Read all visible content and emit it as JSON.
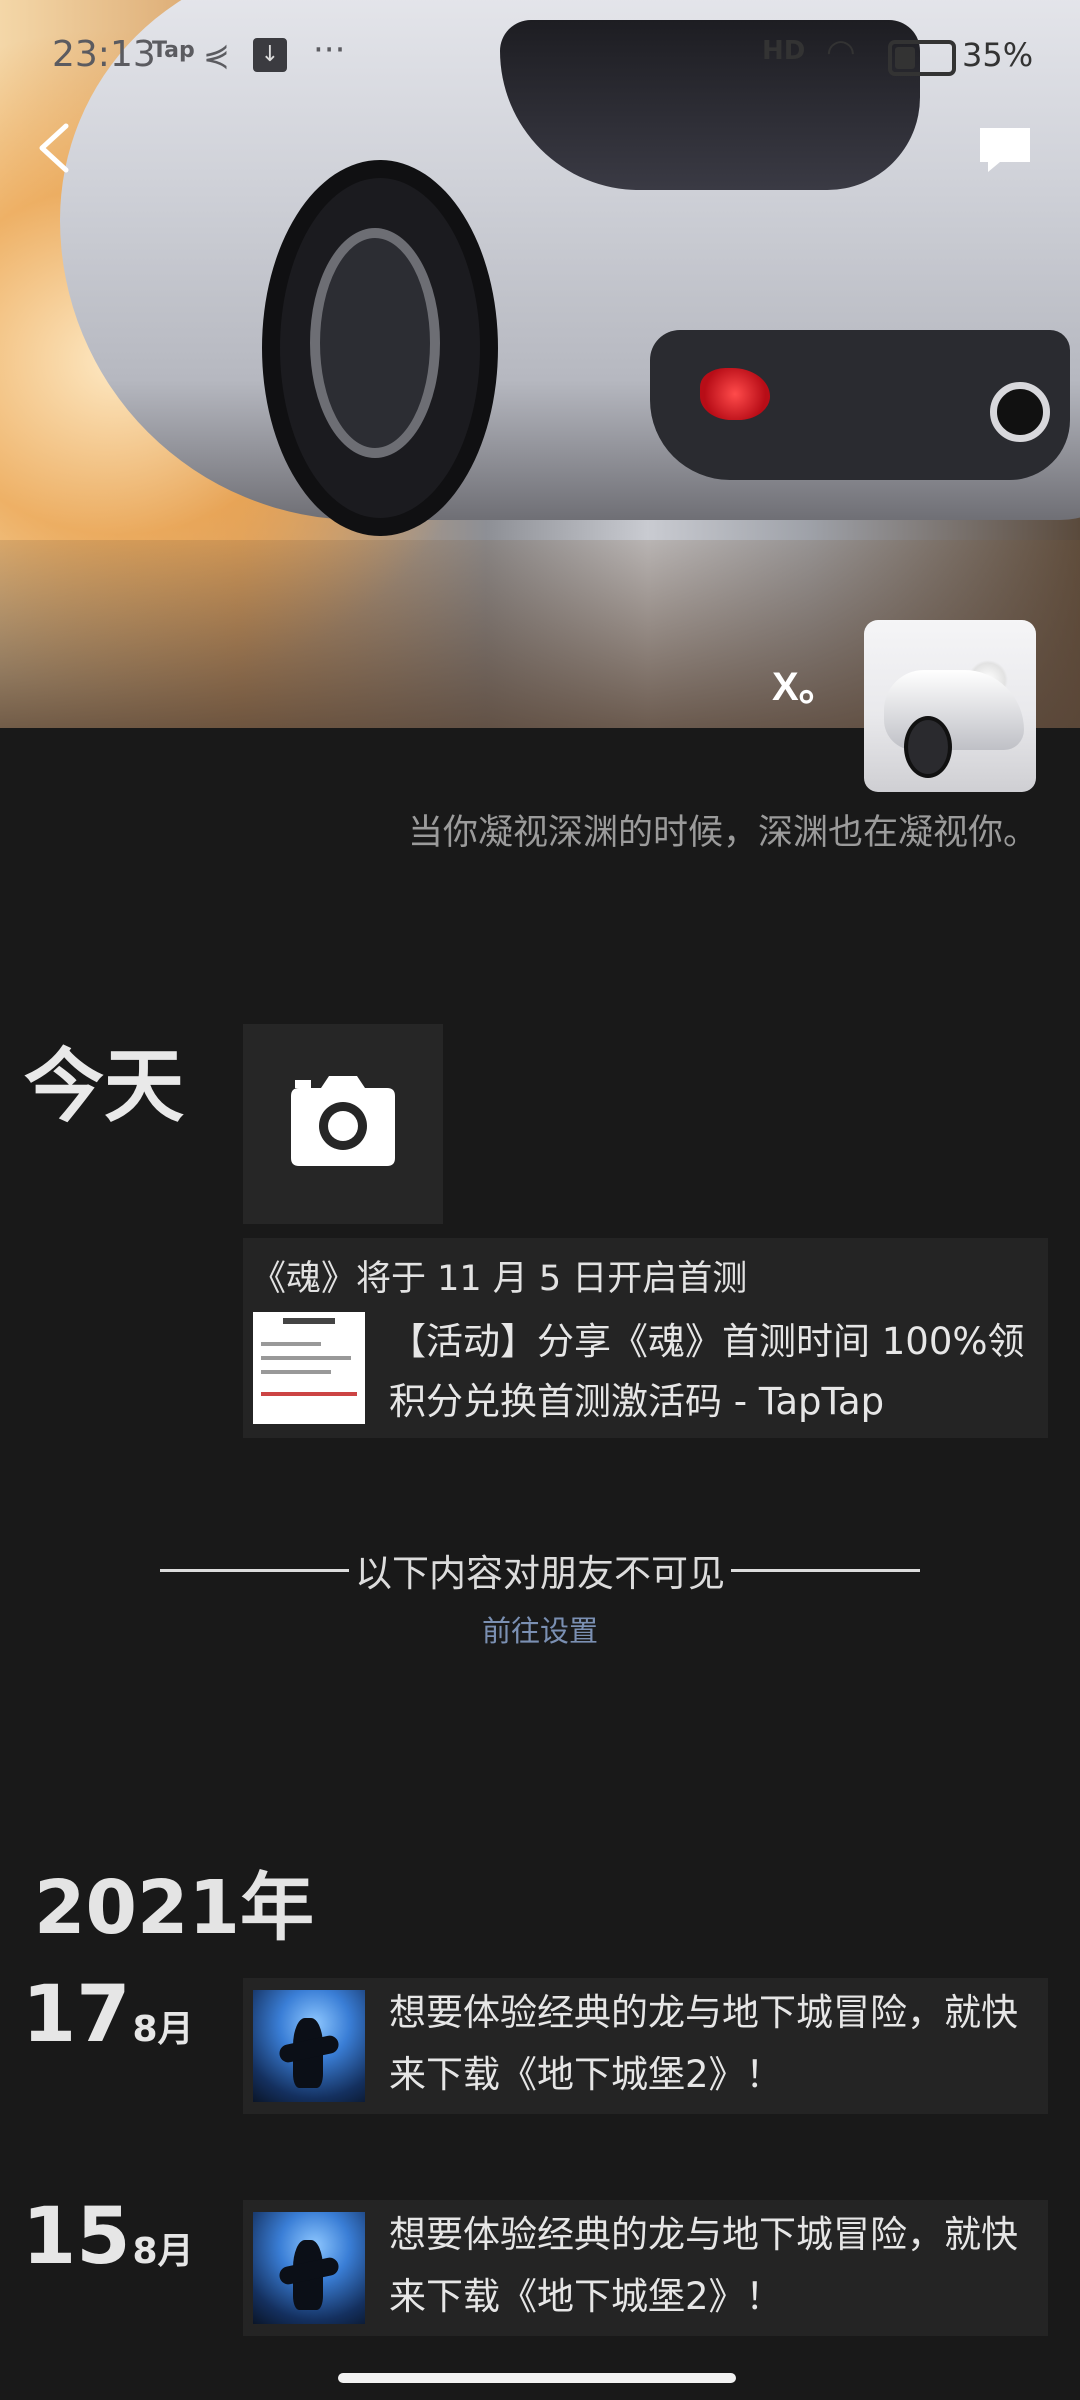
{
  "status_bar": {
    "time": "23:13",
    "tap_label": "Tap",
    "more": "···",
    "network": "HD",
    "battery": "35%",
    "battery_level": 0.35
  },
  "profile": {
    "nickname": "X。",
    "signature": "当你凝视深渊的时候，深渊也在凝视你。"
  },
  "today": {
    "label": "今天",
    "share_title": "《魂》将于 11 月 5 日开启首测",
    "share_text": "【活动】分享《魂》首测时间 100%领积分兑换首测激活码 - TapTap"
  },
  "divider": {
    "text": "以下内容对朋友不可见",
    "link": "前往设置"
  },
  "year": "2021年",
  "posts": [
    {
      "day": "17",
      "month": "8月",
      "text": "想要体验经典的龙与地下城冒险，就快来下载《地下城堡2》！"
    },
    {
      "day": "15",
      "month": "8月",
      "text": "想要体验经典的龙与地下城冒险，就快来下载《地下城堡2》！"
    }
  ],
  "colors": {
    "background": "#191919",
    "card": "#242424",
    "link": "#7b90b3"
  }
}
